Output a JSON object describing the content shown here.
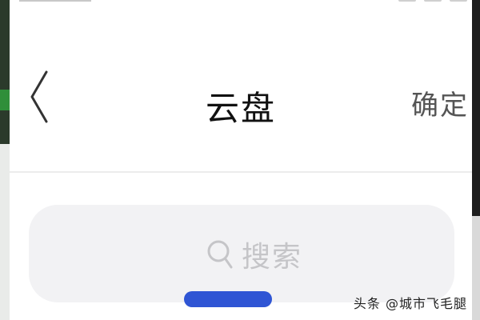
{
  "header": {
    "title": "云盘",
    "back_icon": "chevron-left-icon",
    "confirm_label": "确定"
  },
  "search": {
    "icon": "search-icon",
    "placeholder": "搜索"
  },
  "watermark": {
    "text": "头条 @城市飞毛腿"
  },
  "colors": {
    "accent": "#2f55d4",
    "search_bg": "#f2f2f4",
    "placeholder": "#c5c5c8"
  }
}
